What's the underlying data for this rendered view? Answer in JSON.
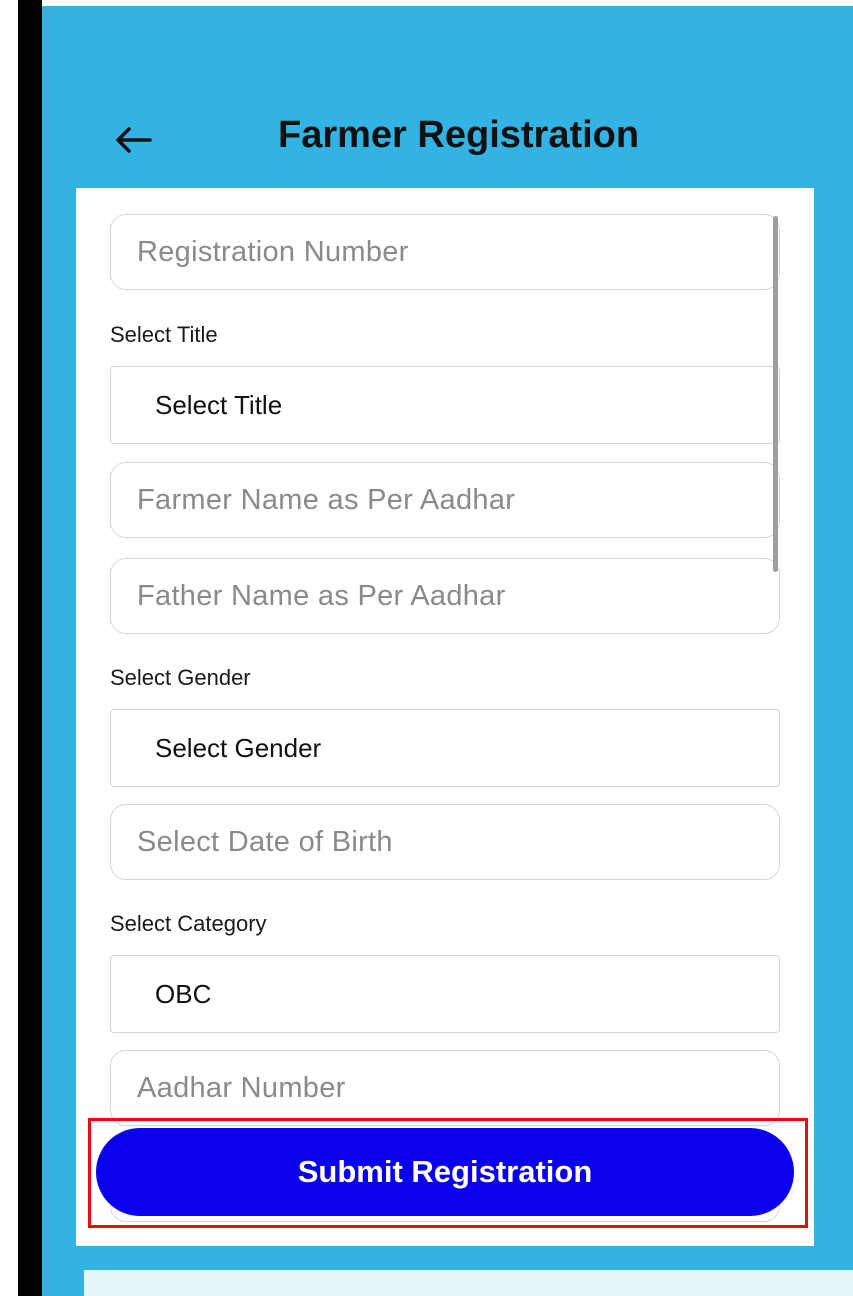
{
  "colors": {
    "header_bg": "#33b3e3",
    "submit_bg": "#0a00ee",
    "highlight_border": "#e01010",
    "placeholder_text": "#8a8a8a"
  },
  "header": {
    "back_icon": "arrow-left-icon",
    "title": "Farmer Registration"
  },
  "form": {
    "registration_number": {
      "placeholder": "Registration Number",
      "value": ""
    },
    "title_label": "Select Title",
    "title_select": {
      "selected": "Select Title"
    },
    "farmer_name": {
      "placeholder": "Farmer Name as Per Aadhar",
      "value": ""
    },
    "father_name": {
      "placeholder": "Father Name as Per Aadhar",
      "value": ""
    },
    "gender_label": "Select Gender",
    "gender_select": {
      "selected": "Select Gender"
    },
    "dob": {
      "placeholder": "Select Date of Birth",
      "value": ""
    },
    "category_label": "Select Category",
    "category_select": {
      "selected": "OBC"
    },
    "aadhar_number": {
      "placeholder": "Aadhar Number",
      "value": ""
    }
  },
  "submit": {
    "label": "Submit Registration"
  }
}
